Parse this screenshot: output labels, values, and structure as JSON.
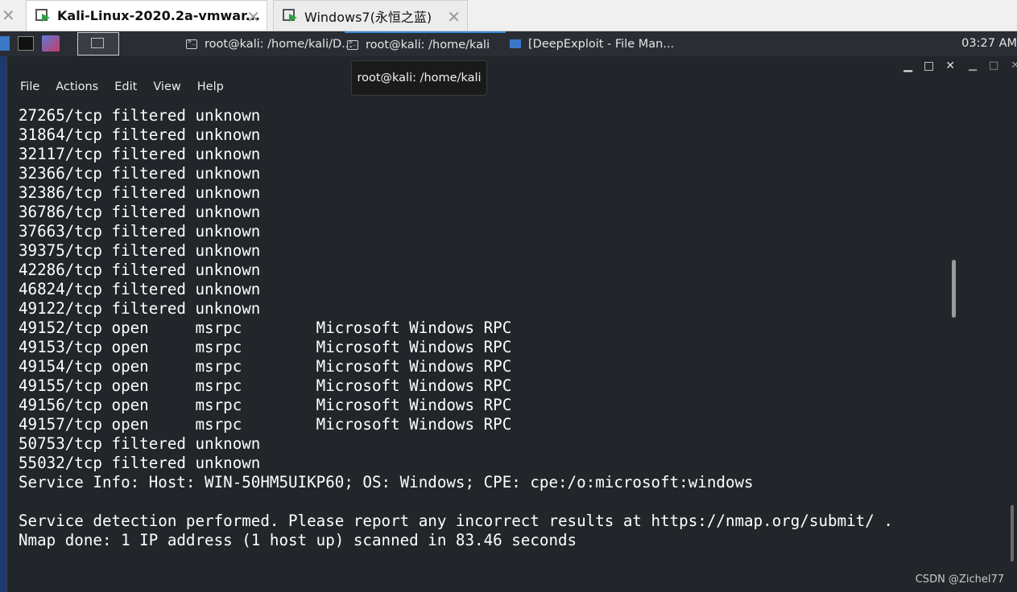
{
  "vm_tabs": [
    {
      "label": "Kali-Linux-2020.2a-vmwar...",
      "active": true
    },
    {
      "label": "Windows7(永恒之蓝)",
      "active": false
    }
  ],
  "panel": {
    "tasks": [
      {
        "label": "root@kali: /home/kali/D..."
      },
      {
        "label": "root@kali: /home/kali"
      },
      {
        "label": "[DeepExploit - File Man..."
      }
    ],
    "clock": "03:27 AM"
  },
  "tooltip": "root@kali: /home/kali",
  "terminal": {
    "menu": [
      "File",
      "Actions",
      "Edit",
      "View",
      "Help"
    ],
    "lines": [
      "27265/tcp filtered unknown",
      "31864/tcp filtered unknown",
      "32117/tcp filtered unknown",
      "32366/tcp filtered unknown",
      "32386/tcp filtered unknown",
      "36786/tcp filtered unknown",
      "37663/tcp filtered unknown",
      "39375/tcp filtered unknown",
      "42286/tcp filtered unknown",
      "46824/tcp filtered unknown",
      "49122/tcp filtered unknown",
      "49152/tcp open     msrpc        Microsoft Windows RPC",
      "49153/tcp open     msrpc        Microsoft Windows RPC",
      "49154/tcp open     msrpc        Microsoft Windows RPC",
      "49155/tcp open     msrpc        Microsoft Windows RPC",
      "49156/tcp open     msrpc        Microsoft Windows RPC",
      "49157/tcp open     msrpc        Microsoft Windows RPC",
      "50753/tcp filtered unknown",
      "55032/tcp filtered unknown",
      "Service Info: Host: WIN-50HM5UIKP60; OS: Windows; CPE: cpe:/o:microsoft:windows",
      "",
      "Service detection performed. Please report any incorrect results at https://nmap.org/submit/ .",
      "Nmap done: 1 IP address (1 host up) scanned in 83.46 seconds"
    ]
  },
  "watermark": "CSDN @Zichel77",
  "colors": {
    "terminal_bg": "#22252a",
    "panel_bg": "#2a2d33",
    "accent": "#3b8de0"
  }
}
